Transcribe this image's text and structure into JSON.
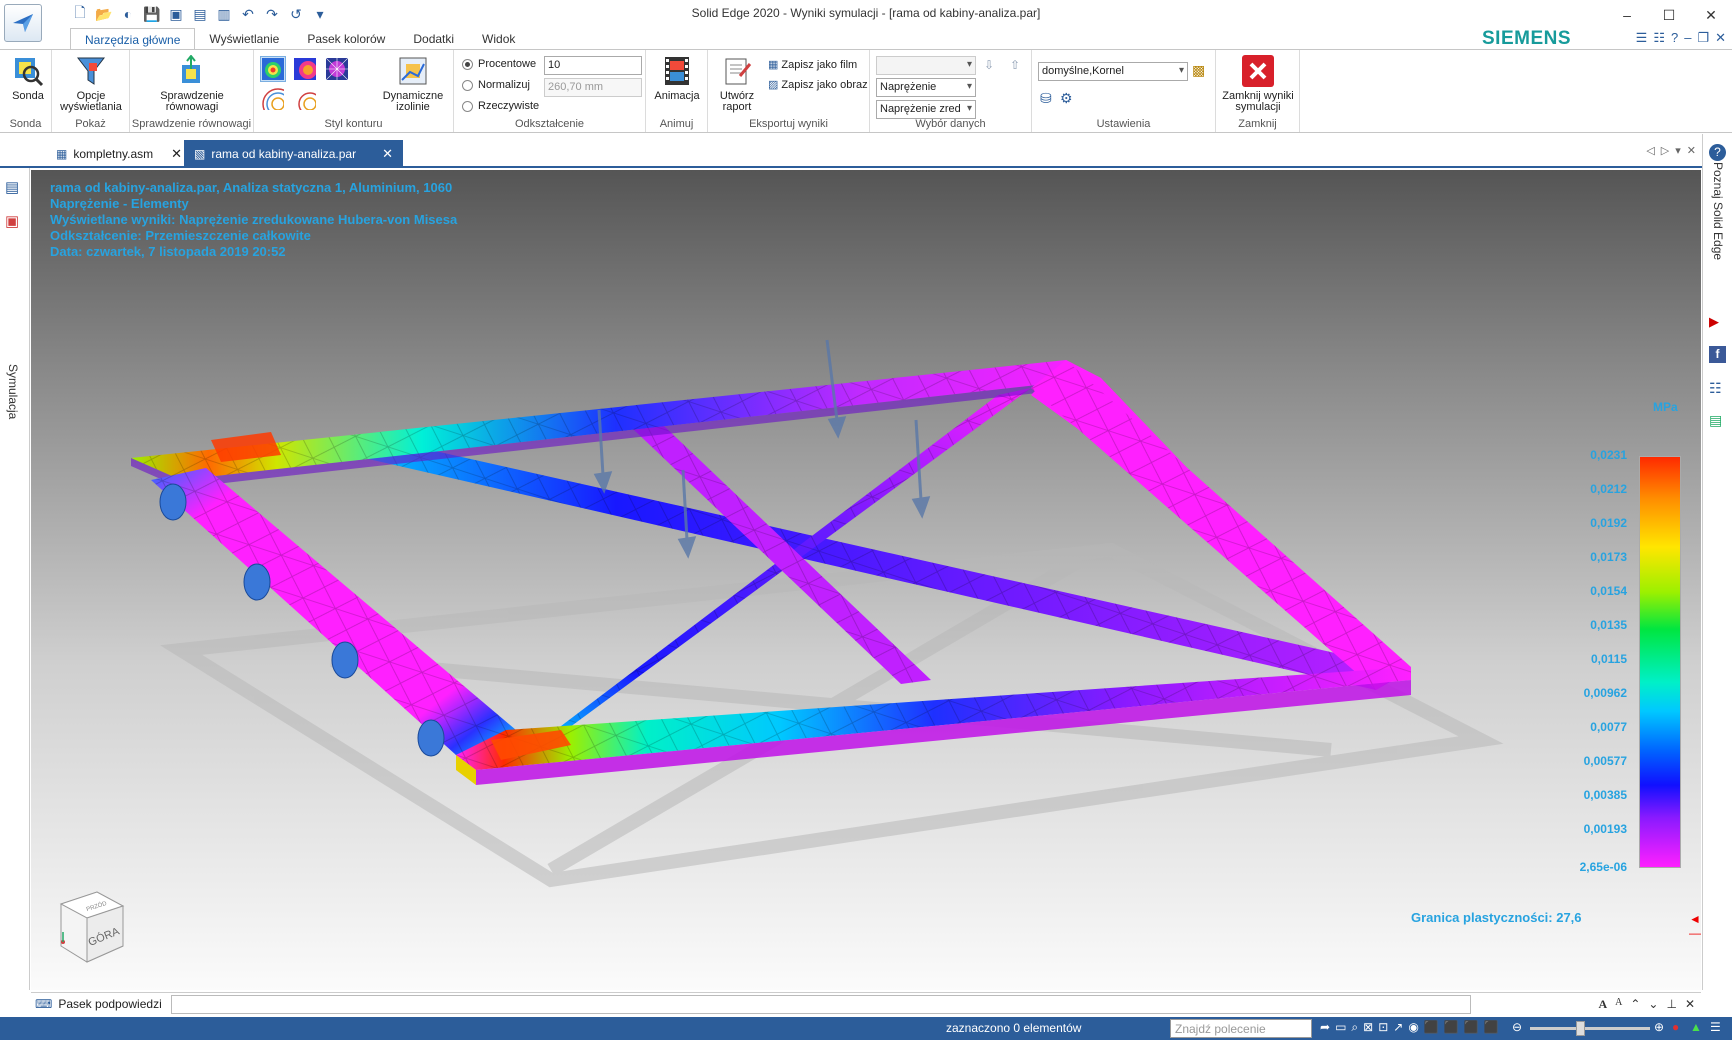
{
  "window": {
    "title": "Solid Edge 2020 - Wyniki symulacji - [rama od kabiny-analiza.par]",
    "brand": "SIEMENS",
    "controls": [
      "–",
      "☐",
      "✕"
    ]
  },
  "ribbon_tabs": [
    "Narzędzia główne",
    "Wyświetlanie",
    "Pasek kolorów",
    "Dodatki",
    "Widok"
  ],
  "ribbon": {
    "sonda": {
      "label": "Sonda",
      "group": "Sonda"
    },
    "pokaz": {
      "label": "Opcje wyświetlania",
      "group": "Pokaż"
    },
    "rownowagi": {
      "label": "Sprawdzenie równowagi",
      "group": "Sprawdzenie równowagi"
    },
    "styl": {
      "group": "Styl konturu"
    },
    "izolinie": {
      "label": "Dynamiczne izolinie"
    },
    "odksztalcenie": {
      "group": "Odkształcenie",
      "options": [
        "Procentowe",
        "Normalizuj",
        "Rzeczywiste"
      ],
      "percent_value": "10",
      "mm_value": "260,70 mm"
    },
    "animuj": {
      "label": "Animacja",
      "group": "Animuj"
    },
    "eksport": {
      "raport": "Utwórz raport",
      "film": "Zapisz jako film",
      "obraz": "Zapisz jako obraz",
      "group": "Eksportuj wyniki"
    },
    "wybor": {
      "combo1": "",
      "combo2": "Naprężenie",
      "combo3": "Naprężenie zred",
      "group": "Wybór danych"
    },
    "ustawienia": {
      "combo": "domyślne,Kornel",
      "group": "Ustawienia"
    },
    "zamknij": {
      "label": "Zamknij wyniki symulacji",
      "group": "Zamknij"
    }
  },
  "doc_tabs": [
    {
      "label": "kompletny.asm",
      "active": false
    },
    {
      "label": "rama od kabiny-analiza.par",
      "active": true
    }
  ],
  "left_rail": {
    "label": "Symulacja"
  },
  "right_rail": {
    "label": "Poznaj Solid Edge"
  },
  "viewport": {
    "info": [
      "rama od kabiny-analiza.par, Analiza statyczna 1, Aluminium, 1060",
      "Naprężenie - Elementy",
      "Wyświetlane wyniki: Naprężenie zredukowane Hubera-von Misesa",
      "Odkształcenie: Przemieszczenie całkowite",
      "Data: czwartek, 7 listopada 2019  20:52"
    ],
    "unit": "MPa",
    "colorbar_labels": [
      "0,0231",
      "0,0212",
      "0,0192",
      "0,0173",
      "0,0154",
      "0,0135",
      "0,0115",
      "0,00962",
      "0,0077",
      "0,00577",
      "0,00385",
      "0,00193",
      "2,65e-06"
    ],
    "yield": "Granica plastyczności: 27,6",
    "cube_face": "GÓRA",
    "cube_side": "PRZÓD",
    "colors": {
      "info_text": "#27a3e0",
      "hot": "#ff2a00",
      "cold": "#ff20ff"
    }
  },
  "hint_bar": {
    "label": "Pasek podpowiedzi",
    "tools": [
      "A",
      "A",
      "⌃",
      "⌄",
      "⊥",
      "✕"
    ]
  },
  "status": {
    "text": "zaznaczono 0 elementów",
    "find_placeholder": "Znajdź polecenie",
    "tools": [
      "➦",
      "▭",
      "⌕",
      "⊠",
      "⊡",
      "↗",
      "◉",
      "⬛",
      "⬛",
      "⬛",
      "⬛",
      "⊖",
      "⊕",
      "●",
      "▲",
      "☰"
    ]
  }
}
